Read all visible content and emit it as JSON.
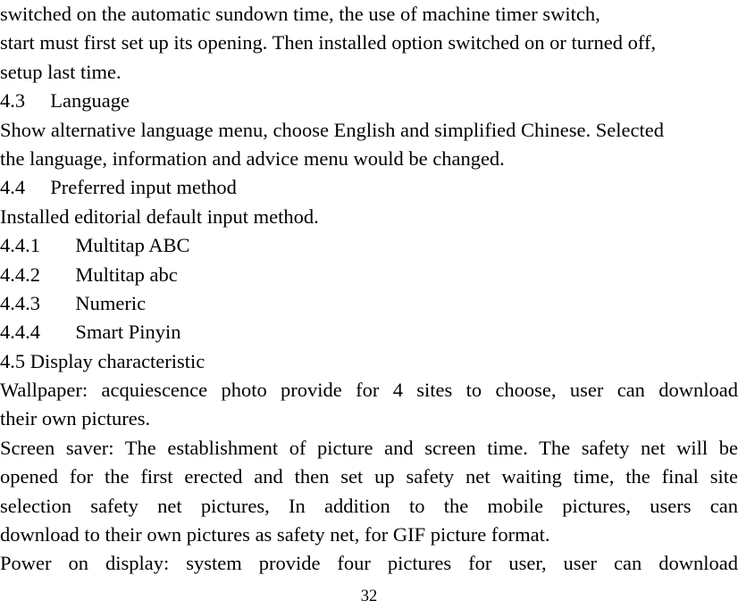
{
  "document": {
    "page_number": "32",
    "lines": [
      {
        "id": "l01",
        "text": "switched on the automatic sundown time, the use of machine timer switch,",
        "justified": false
      },
      {
        "id": "l02",
        "text": "start must first set up its opening. Then installed option switched on or turned off,",
        "justified": false
      },
      {
        "id": "l03",
        "text": "setup last time.",
        "justified": false
      },
      {
        "id": "l04",
        "text": "4.3  Language",
        "justified": false
      },
      {
        "id": "l05",
        "text": "Show alternative language menu, choose English and simplified Chinese. Selected",
        "justified": false
      },
      {
        "id": "l06",
        "text": "the language, information and advice menu would be changed.",
        "justified": false
      },
      {
        "id": "l07",
        "text": "4.4  Preferred input method",
        "justified": false
      },
      {
        "id": "l08",
        "text": "Installed editorial default input method.",
        "justified": false
      },
      {
        "id": "l09",
        "text": "4.4.1   Multitap ABC",
        "justified": false
      },
      {
        "id": "l10",
        "text": "4.4.2   Multitap abc",
        "justified": false
      },
      {
        "id": "l11",
        "text": "4.4.3   Numeric",
        "justified": false
      },
      {
        "id": "l12",
        "text": "4.4.4   Smart Pinyin",
        "justified": false
      },
      {
        "id": "l13",
        "text": "4.5 Display characteristic",
        "justified": false
      },
      {
        "id": "l14",
        "text": "Wallpaper: acquiescence photo provide for 4 sites to choose, user can download",
        "justified": true
      },
      {
        "id": "l15",
        "text": "their own pictures.",
        "justified": false
      },
      {
        "id": "l16",
        "text": "Screen saver: The establishment of picture and screen time. The safety net will be",
        "justified": true
      },
      {
        "id": "l17",
        "text": "opened for the first erected and then set up safety net waiting time, the final site",
        "justified": true
      },
      {
        "id": "l18",
        "text": "selection safety net pictures, In addition to the mobile pictures, users can",
        "justified": true
      },
      {
        "id": "l19",
        "text": "download to their own pictures as safety net, for GIF picture format.",
        "justified": false
      },
      {
        "id": "l20",
        "text": "Power on display: system provide four pictures for user,  user can download",
        "justified": true
      }
    ],
    "sections": {
      "s43_number": "4.3",
      "s43_title": "Language",
      "s44_number": "4.4",
      "s44_title": "Preferred input method",
      "s441": "4.4.1",
      "s441_title": "Multitap ABC",
      "s442": "4.4.2",
      "s442_title": "Multitap abc",
      "s443": "4.4.3",
      "s443_title": "Numeric",
      "s444": "4.4.4",
      "s444_title": "Smart Pinyin",
      "s45": "4.5 Display characteristic"
    }
  }
}
